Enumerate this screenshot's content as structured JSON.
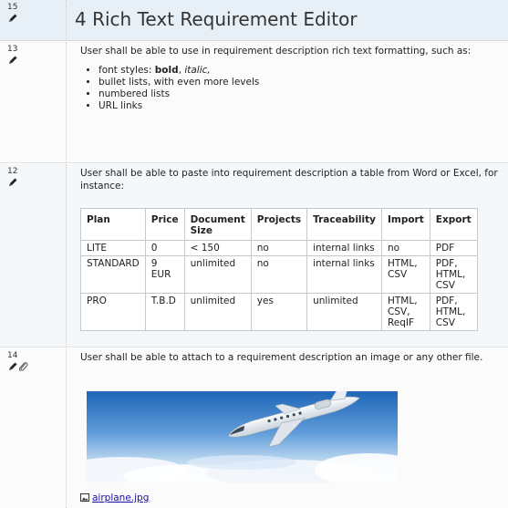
{
  "section": {
    "id": "15",
    "title": "4 Rich Text Requirement Editor"
  },
  "requirements": [
    {
      "id": "13",
      "text": "User shall be able to use in requirement description rich text formatting, such as:",
      "bullets": {
        "font_styles_prefix": "font styles: ",
        "bold": "bold",
        "separator": ", ",
        "italic": "italic,",
        "items": [
          "bullet lists, with even more levels",
          "numbered lists",
          "URL links"
        ]
      }
    },
    {
      "id": "12",
      "text": "User shall be able to paste into requirement description a table from Word or Excel, for instance:",
      "table": {
        "headers": [
          "Plan",
          "Price",
          "Document Size",
          "Projects",
          "Traceability",
          "Import",
          "Export"
        ],
        "rows": [
          [
            "LITE",
            "0",
            "< 150",
            "no",
            "internal links",
            "no",
            "PDF"
          ],
          [
            "STANDARD",
            "9 EUR",
            "unlimited",
            "no",
            "internal links",
            "HTML, CSV",
            "PDF, HTML, CSV"
          ],
          [
            "PRO",
            "T.B.D",
            "unlimited",
            "yes",
            "unlimited",
            "HTML, CSV, ReqIF",
            "PDF, HTML, CSV"
          ]
        ]
      }
    },
    {
      "id": "14",
      "text": "User shall be able to attach to a requirement description an image or any other file.",
      "attachment": "airplane.jpg"
    }
  ],
  "icons": {
    "edit": "pencil-icon",
    "attachment": "paperclip-icon",
    "image": "image-file-icon"
  },
  "colors": {
    "header_bg": "#e8f0f7",
    "link": "#1a0dab"
  }
}
